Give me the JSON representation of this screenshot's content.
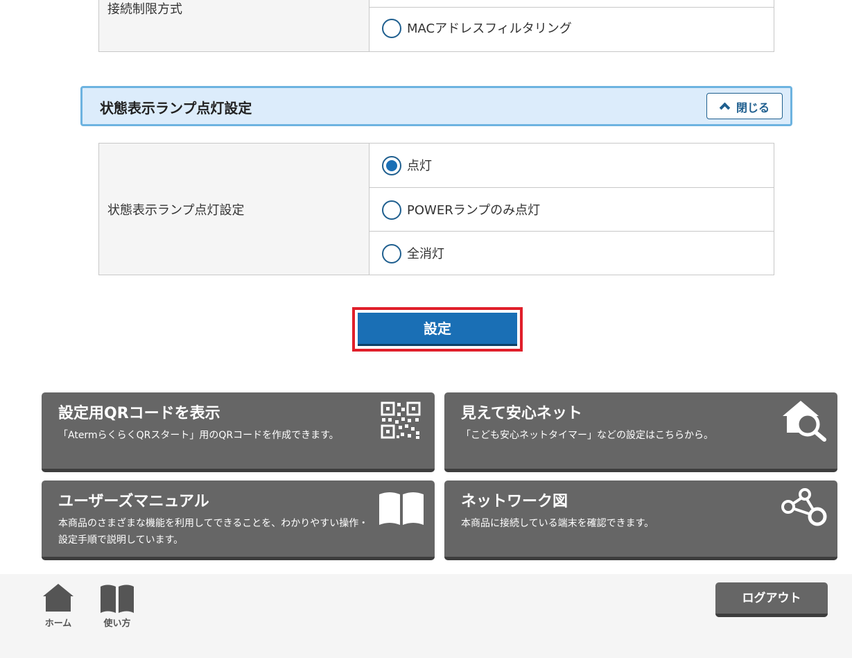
{
  "connection_table": {
    "label": "接続制限方式",
    "options": [
      {
        "label": "MACアドレスフィルタリング",
        "checked": false
      }
    ]
  },
  "lamp_section": {
    "title": "状態表示ランプ点灯設定",
    "close_label": "閉じる"
  },
  "lamp_table": {
    "label": "状態表示ランプ点灯設定",
    "options": [
      {
        "label": "点灯",
        "checked": true
      },
      {
        "label": "POWERランプのみ点灯",
        "checked": false
      },
      {
        "label": "全消灯",
        "checked": false
      }
    ]
  },
  "apply_label": "設定",
  "cards": [
    {
      "title": "設定用QRコードを表示",
      "desc": "「AtermらくらくQRスタート」用のQRコードを作成できます。",
      "icon": "qr-code-icon"
    },
    {
      "title": "見えて安心ネット",
      "desc": "「こども安心ネットタイマー」などの設定はこちらから。",
      "icon": "house-search-icon"
    },
    {
      "title": "ユーザーズマニュアル",
      "desc": "本商品のさまざまな機能を利用してできることを、わかりやすい操作・設定手順で説明しています。",
      "icon": "book-icon"
    },
    {
      "title": "ネットワーク図",
      "desc": "本商品に接続している端末を確認できます。",
      "icon": "network-icon"
    }
  ],
  "footer": {
    "home_label": "ホーム",
    "manual_label": "使い方",
    "logout_label": "ログアウト"
  },
  "colors": {
    "primary": "#1a6fb5",
    "highlight": "#e01f2a",
    "card": "#666666",
    "section_bg": "#dcecfb"
  }
}
